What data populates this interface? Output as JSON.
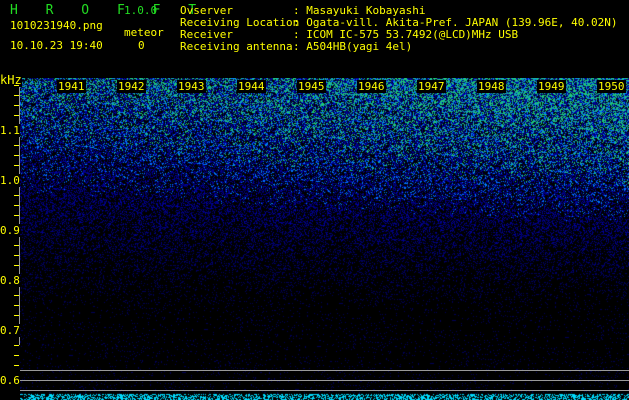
{
  "header": {
    "app_name": "H R O F F T",
    "version": "1.0.0",
    "filename": "1010231940.png",
    "datetime": "10.10.23 19:40",
    "meteor_label": "meteor",
    "meteor_count": "0"
  },
  "info": [
    {
      "label": "Ovserver",
      "value": ": Masayuki Kobayashi"
    },
    {
      "label": "Receiving Location",
      "value": ": Ogata-vill. Akita-Pref. JAPAN (139.96E, 40.02N)"
    },
    {
      "label": "Receiver",
      "value": ": ICOM IC-575 53.7492(@LCD)MHz USB"
    },
    {
      "label": "Receiving antenna",
      "value": ": A504HB(yagi 4el)"
    }
  ],
  "spectrogram": {
    "unit": "kHz",
    "y_labels": [
      "1.1",
      "1.0",
      "0.9",
      "0.8",
      "0.7",
      "0.6"
    ],
    "minute_labels": [
      "1941",
      "1942",
      "1943",
      "1944",
      "1945",
      "1946",
      "1947",
      "1948",
      "1949",
      "1950"
    ],
    "colors": {
      "text": "#ffff00",
      "logo": "#22dd22",
      "noise_low": "#0000aa",
      "noise_high": "#22ff66",
      "bottom": "#00ddff"
    }
  }
}
